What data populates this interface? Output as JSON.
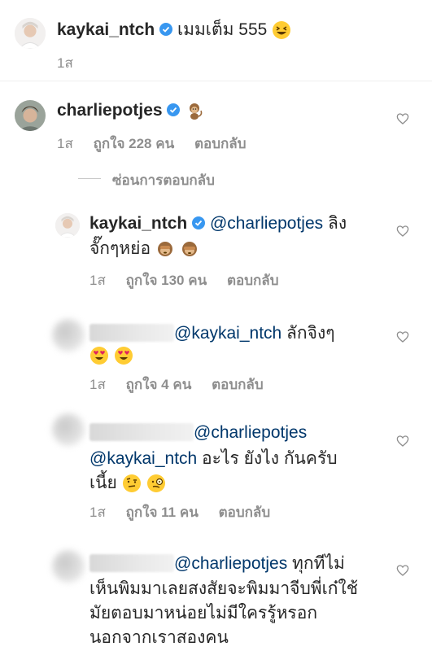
{
  "post": {
    "username": "kaykai_ntch",
    "caption": "เมมเต็ม 555",
    "emoji": "grinning-squinting-face",
    "time": "1ส"
  },
  "comments": [
    {
      "username": "charliepotjes",
      "emoji": "monkey",
      "time": "1ส",
      "likes": "ถูกใจ 228 คน",
      "reply": "ตอบกลับ"
    }
  ],
  "hide_replies": "ซ่อนการตอบกลับ",
  "replies": [
    {
      "username": "kaykai_ntch",
      "mention": "@charliepotjes",
      "line1_tail": " ลิง",
      "line2": "จั๊กๆหย่อ",
      "emojis": [
        "see-no-evil-monkey",
        "see-no-evil-monkey"
      ],
      "time": "1ส",
      "likes": "ถูกใจ 130 คน",
      "reply": "ตอบกลับ"
    },
    {
      "mention": "@kaykai_ntch",
      "line1_tail": " ลักจิงๆ",
      "emojis": [
        "heart-eyes",
        "heart-eyes"
      ],
      "time": "1ส",
      "likes": "ถูกใจ 4 คน",
      "reply": "ตอบกลับ"
    },
    {
      "mention": "@charliepotjes",
      "line2_mention": "@kaykai_ntch",
      "line2_tail": " อะไร ยังไง กันครับ",
      "line3": "เนี้ย",
      "emojis": [
        "raised-eyebrow-face",
        "monocle-face"
      ],
      "time": "1ส",
      "likes": "ถูกใจ 11 คน",
      "reply": "ตอบกลับ"
    },
    {
      "mention": "@charliepotjes",
      "line1_tail": " ทุกทีไม่",
      "line2": "เห็นพิมมาเลยสงสัยจะพิมมาจีบพี่เก๋ใช้",
      "line3": "มัยตอบมาหน่อยไม่มีใครรู้หรอก",
      "line4": "นอกจากเราสองคน"
    }
  ],
  "colors": {
    "text": "#262626",
    "meta": "#8e8e8e",
    "mention": "#00376b",
    "verified": "#3897f0"
  }
}
